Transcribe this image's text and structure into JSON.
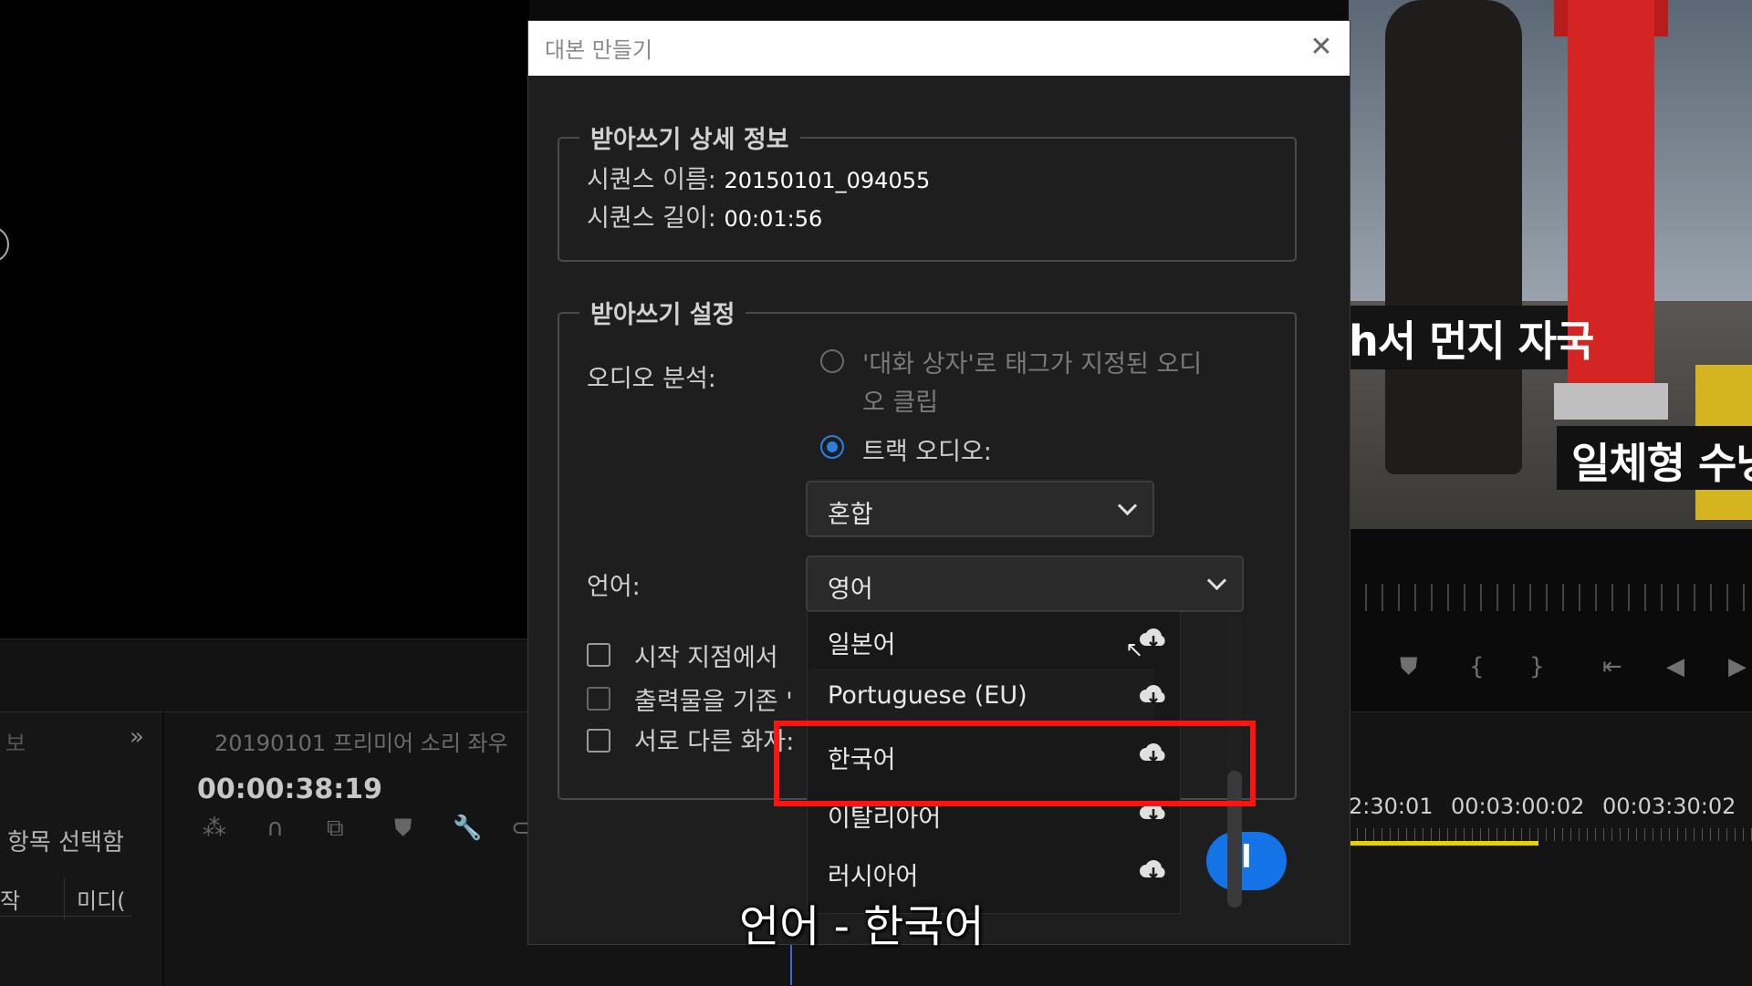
{
  "dialog": {
    "title": "대본 만들기",
    "details": {
      "legend": "받아쓰기 상세 정보",
      "sequence_name_label": "시퀀스 이름:",
      "sequence_name_value": "20150101_094055",
      "sequence_length_label": "시퀀스 길이:",
      "sequence_length_value": "00:01:56"
    },
    "settings": {
      "legend": "받아쓰기 설정",
      "audio_analysis_label": "오디오 분석:",
      "radio_dialogue_line1": "'대화 상자'로 태그가 지정된 오디",
      "radio_dialogue_line2": "오 클립",
      "radio_track_label": "트랙 오디오:",
      "track_select_value": "혼합",
      "language_label": "언어:",
      "language_select_value": "영어",
      "checkbox_1_label": "시작 지점에서 ",
      "checkbox_2_label": "출력물을 기존 '",
      "checkbox_3_label": "서로 다른 화자:"
    },
    "language_options": [
      "일본어",
      "Portuguese (EU)",
      "한국어",
      "이탈리아어",
      "러시아어"
    ],
    "primary_button_fragment": "l"
  },
  "background": {
    "caption_1": "h서 먼지 자국",
    "caption_2": "일체형 수냉",
    "timeline_sequence_name": "20190101 프리미어 소리 좌우",
    "timeline_timecode": "00:00:38:19",
    "ruler_labels": [
      "2:30:01",
      "00:03:00:02",
      "00:03:30:02"
    ],
    "project_title": "보",
    "project_arrows": "»",
    "project_selected": "항목 선택함",
    "project_col_1": "작",
    "project_col_2": "미디(",
    "program_controls": [
      "⛊",
      "{",
      "}",
      "⇤",
      "◀",
      "▶"
    ],
    "timeline_tools": [
      "⁂",
      "∩",
      "⧉",
      "⛊",
      "🔧",
      "⊂"
    ]
  },
  "subtitle": "언어 - 한국어",
  "colors": {
    "accent": "#2a7de1",
    "highlight": "#ff1212",
    "button": "#1473e6"
  }
}
